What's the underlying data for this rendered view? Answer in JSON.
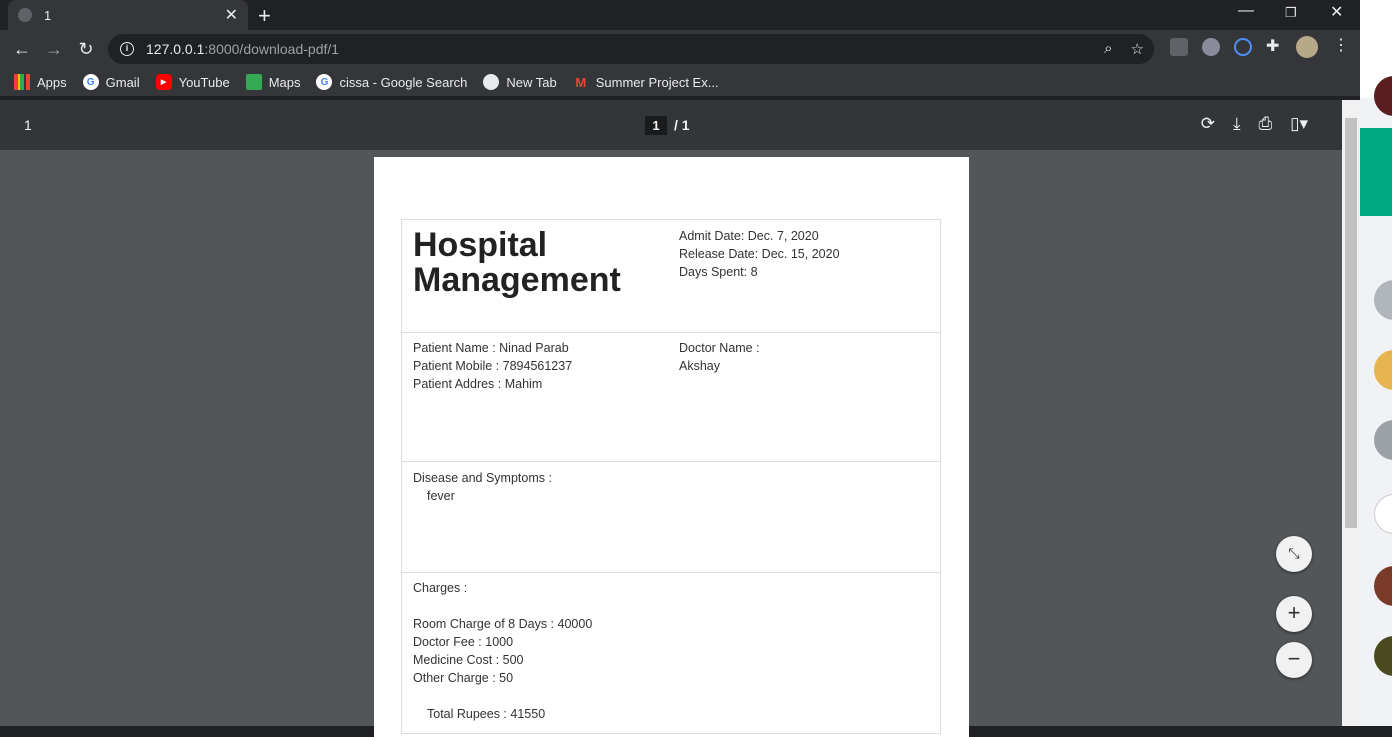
{
  "browser": {
    "tab_title": "1",
    "url_host": "127.0.0.1",
    "url_path": ":8000/download-pdf/1",
    "bookmarks": [
      "Apps",
      "Gmail",
      "YouTube",
      "Maps",
      "cissa - Google Search",
      "New Tab",
      "Summer Project Ex..."
    ]
  },
  "pdf": {
    "doc_title": "1",
    "current_page": "1",
    "page_total": "/ 1"
  },
  "document": {
    "heading_line1": "Hospital",
    "heading_line2": "Management",
    "admit_date": "Admit Date: Dec. 7, 2020",
    "release_date": "Release Date: Dec. 15, 2020",
    "days_spent": "Days Spent: 8",
    "patient_name": "Patient Name : Ninad Parab",
    "patient_mobile": "Patient Mobile : 7894561237",
    "patient_address": "Patient Addres : Mahim",
    "doctor_label": "Doctor Name :",
    "doctor_name": "Akshay",
    "disease_label": "Disease and Symptoms :",
    "disease_value": "fever",
    "charges_label": "Charges :",
    "room_charge": "Room Charge of 8 Days : 40000",
    "doctor_fee": "Doctor Fee : 1000",
    "medicine_cost": "Medicine Cost : 500",
    "other_charge": "Other Charge : 50",
    "total": "Total Rupees : 41550"
  }
}
